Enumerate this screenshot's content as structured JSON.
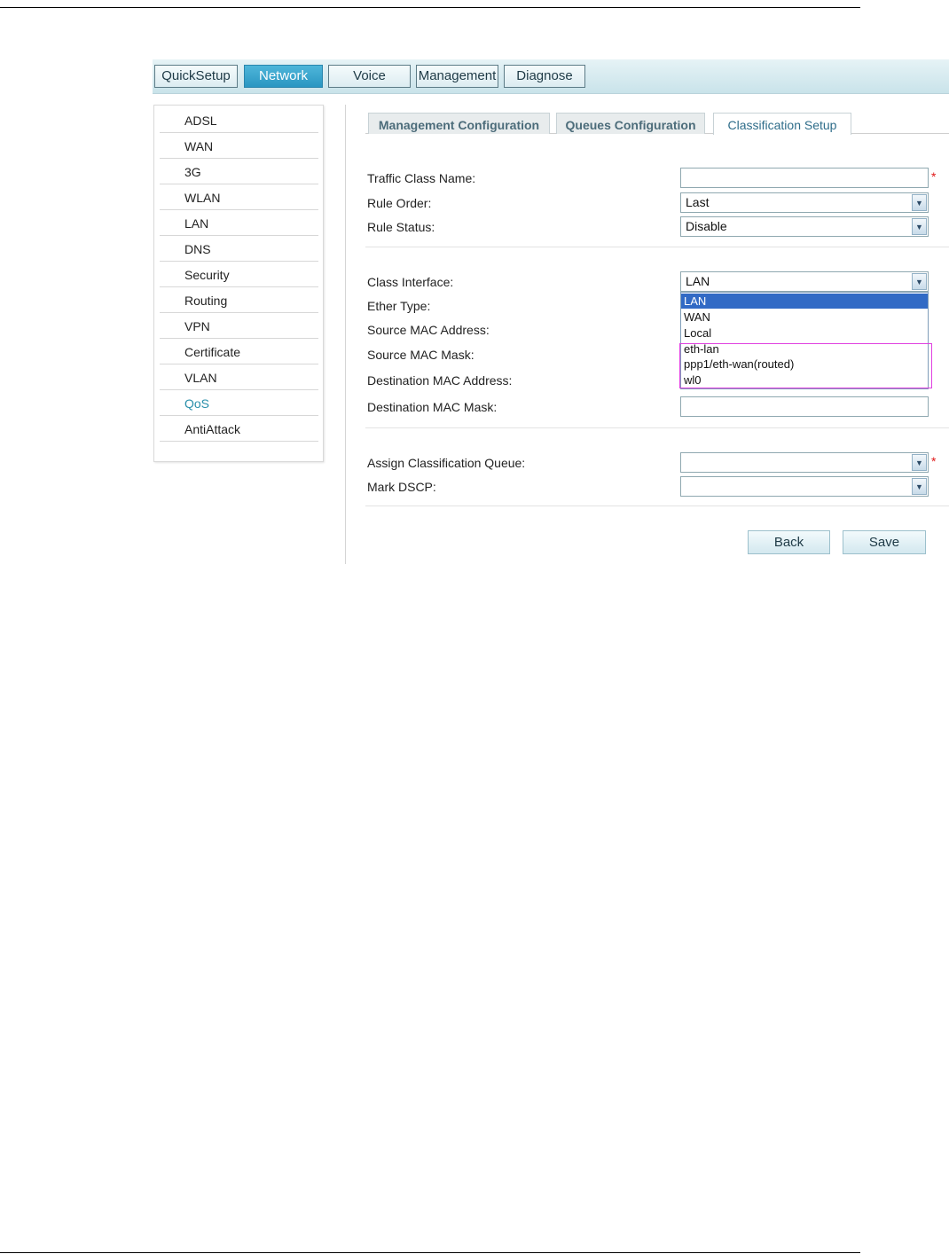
{
  "top_nav": {
    "tabs": [
      {
        "label": "QuickSetup",
        "active": false
      },
      {
        "label": "Network",
        "active": true
      },
      {
        "label": "Voice",
        "active": false
      },
      {
        "label": "Management",
        "active": false
      },
      {
        "label": "Diagnose",
        "active": false
      }
    ]
  },
  "sidebar": {
    "items": [
      {
        "label": "ADSL"
      },
      {
        "label": "WAN"
      },
      {
        "label": "3G"
      },
      {
        "label": "WLAN"
      },
      {
        "label": "LAN"
      },
      {
        "label": "DNS"
      },
      {
        "label": "Security"
      },
      {
        "label": "Routing"
      },
      {
        "label": "VPN"
      },
      {
        "label": "Certificate"
      },
      {
        "label": "VLAN"
      },
      {
        "label": "QoS",
        "active": true
      },
      {
        "label": "AntiAttack"
      }
    ]
  },
  "sub_tabs": [
    {
      "label": "Management Configuration",
      "active": false
    },
    {
      "label": "Queues Configuration",
      "active": false
    },
    {
      "label": "Classification Setup",
      "active": true
    }
  ],
  "form": {
    "traffic_class_name": {
      "label": "Traffic Class Name:",
      "value": ""
    },
    "rule_order": {
      "label": "Rule Order:",
      "value": "Last"
    },
    "rule_status": {
      "label": "Rule Status:",
      "value": "Disable"
    },
    "class_interface": {
      "label": "Class Interface:",
      "value": "LAN"
    },
    "ether_type": {
      "label": "Ether Type:"
    },
    "source_mac_address": {
      "label": "Source MAC Address:"
    },
    "source_mac_mask": {
      "label": "Source MAC Mask:"
    },
    "destination_mac_address": {
      "label": "Destination MAC Address:"
    },
    "destination_mac_mask": {
      "label": "Destination MAC Mask:",
      "value": ""
    },
    "assign_classification_queue": {
      "label": "Assign Classification Queue:",
      "value": ""
    },
    "mark_dscp": {
      "label": "Mark DSCP:",
      "value": ""
    },
    "required_mark": "*"
  },
  "class_interface_dropdown": {
    "options": [
      "LAN",
      "WAN",
      "Local",
      "eth-lan",
      "ppp1/eth-wan(routed)",
      "wl0"
    ],
    "selected": "LAN"
  },
  "buttons": {
    "back": "Back",
    "save": "Save"
  },
  "colors": {
    "accent": "#2a96c2",
    "highlight_box": "#e040e0",
    "required": "#e01818",
    "selected_option": "#316ac5"
  },
  "icons": {
    "select_arrow": "chevron-down-icon"
  }
}
